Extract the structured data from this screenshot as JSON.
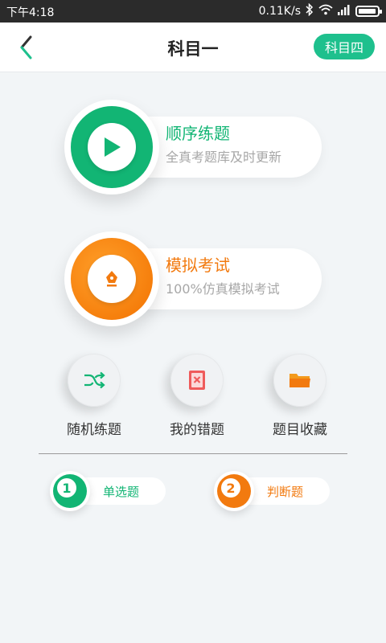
{
  "status_bar": {
    "time": "下午4:18",
    "net_speed": "0.11K/s",
    "battery_percent": 95
  },
  "header": {
    "title": "科目一",
    "switch_label": "科目四"
  },
  "cards": {
    "sequential": {
      "title": "顺序练题",
      "subtitle": "全真考题库及时更新"
    },
    "mock": {
      "title": "模拟考试",
      "subtitle": "100%仿真模拟考试"
    }
  },
  "tools": [
    {
      "label": "随机练题",
      "icon": "shuffle-icon"
    },
    {
      "label": "我的错题",
      "icon": "wrong-book-icon"
    },
    {
      "label": "题目收藏",
      "icon": "folder-icon"
    }
  ],
  "filters": [
    {
      "number": "1",
      "label": "单选题"
    },
    {
      "number": "2",
      "label": "判断题"
    }
  ],
  "colors": {
    "green": "#12b574",
    "orange": "#f27a0f",
    "accent_button": "#1ec08d"
  }
}
